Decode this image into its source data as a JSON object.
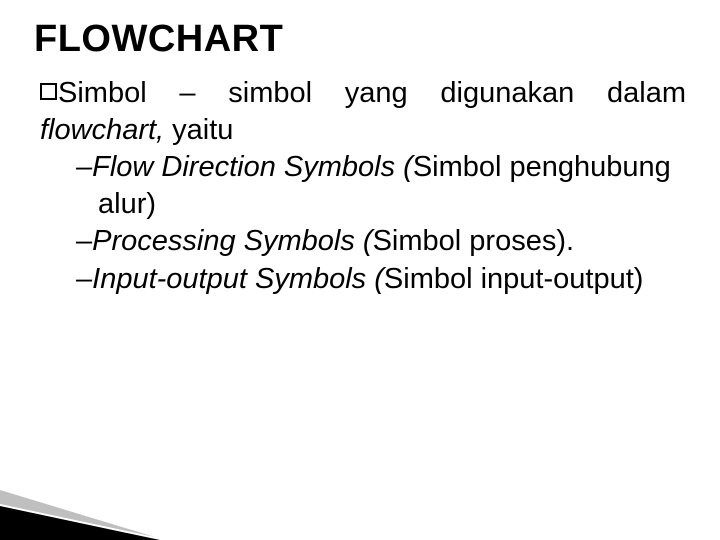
{
  "title": "FLOWCHART",
  "intro": {
    "lead": "Simbol",
    "mid1": " – simbol yang digunakan dalam ",
    "em": "flowchart,",
    "mid2": " yaitu"
  },
  "items": [
    {
      "dash": "–",
      "em": "Flow Direction Symbols (",
      "plain1": "Simbol penghubung alur)"
    },
    {
      "dash": "–",
      "em": "Processing Symbols (",
      "plain1": "Simbol proses)."
    },
    {
      "dash": "–",
      "em": "Input-output Symbols (",
      "plain1": "Simbol input-output)"
    }
  ]
}
